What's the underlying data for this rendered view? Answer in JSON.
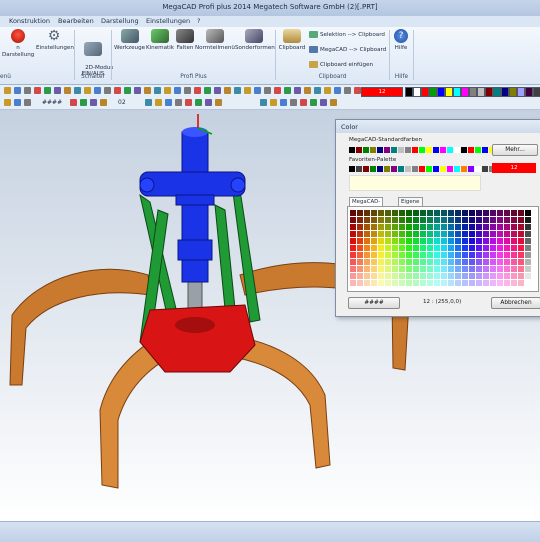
{
  "window": {
    "title": "MegaCAD Profi plus 2014  Megatech Software GmbH (2)[.PRT]"
  },
  "menu": {
    "tabs": [
      "Konstruktion",
      "Bearbeiten",
      "Darstellung",
      "Einstellungen",
      "?"
    ]
  },
  "ribbon": {
    "groups": {
      "menu_label": "enü",
      "schalter_label": "Schalter",
      "profi_label": "Profi Plus",
      "clipboard_label": "Clipboard",
      "hilfe_label": "Hilfe"
    },
    "buttons": {
      "darstellung": "n Darstellung",
      "einstellungen": "Einstellungen",
      "mode2d": "2D-Modus\nEIN/AUS",
      "werkzeuge": "Werkzeuge",
      "kinematik": "Kinematik",
      "falten": "Falten",
      "normteile": "Normteilmenü",
      "sonderformen": "Sonderformen",
      "clipboard": "Clipboard",
      "selektion": "Selektion --> Clipboard",
      "megacad_clip": "MegaCAD --> Clipboard",
      "clip_einfuegen": "Clipboard einfügen",
      "hilfe": "Hilfe"
    }
  },
  "toolbar": {
    "line_style": "####",
    "layer_num": "02",
    "color_swatch_text": "12",
    "palette": [
      "#000000",
      "#ffffff",
      "#ff0000",
      "#00a000",
      "#0000ff",
      "#ffff00",
      "#00ffff",
      "#ff00ff",
      "#808080",
      "#c0c0c0",
      "#800000",
      "#008080",
      "#000080",
      "#808000",
      "#a0a0ff",
      "#400040",
      "#404040"
    ]
  },
  "dialog": {
    "title": "Color",
    "standard_label": "MegaCAD-Standardfarben",
    "favorites_label": "Favoriten-Palette",
    "more_button": "Mehr...",
    "current_color_text": "12",
    "tab_palette": "MegaCAD-Palette",
    "tab_own": "Eigene Palette",
    "pattern_button": "####",
    "readout": "12 : (255,0,0)",
    "cancel_button": "Abbrechen",
    "standard_colors": [
      "#000000",
      "#800000",
      "#008000",
      "#808000",
      "#000080",
      "#800080",
      "#008080",
      "#c0c0c0",
      "#808080",
      "#ff0000",
      "#00ff00",
      "#ffff00",
      "#0000ff",
      "#ff00ff",
      "#00ffff",
      "#ffffff",
      "#000000",
      "#ff0000",
      "#00ff00",
      "#0000ff",
      "#ffff00",
      "#ff00ff",
      "#00ffff",
      "#ffffff"
    ],
    "favorite_colors": [
      "#000000",
      "#404040",
      "#800000",
      "#008000",
      "#000080",
      "#808000",
      "#800080",
      "#008080",
      "#c0c0c0",
      "#808080",
      "#ff0000",
      "#00ff00",
      "#0000ff",
      "#ffff00",
      "#ff00ff",
      "#00ffff",
      "#ff8000",
      "#8000ff",
      "#ffffff",
      "#404040",
      "#808080",
      "#c0c0c0",
      "#e0e0e0",
      "#ffffff"
    ],
    "selected_color": "#ff0000"
  },
  "model": {
    "description_colors": {
      "claws": "#c7772b",
      "frame": "#1c8f2a",
      "cylinder": "#1a33e6",
      "hub": "#d81414"
    }
  }
}
